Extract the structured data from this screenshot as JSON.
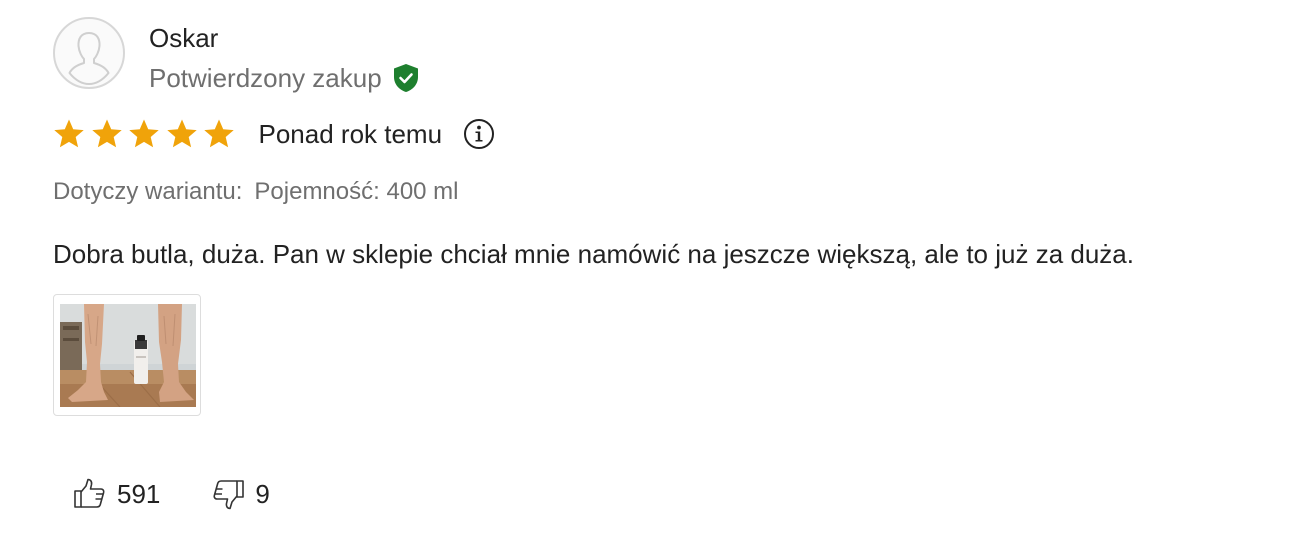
{
  "review": {
    "author": {
      "name": "Oskar",
      "avatar_icon": "user-silhouette-icon"
    },
    "verified": {
      "label": "Potwierdzony zakup",
      "icon": "shield-check-icon",
      "color": "#1e7f2e"
    },
    "rating": {
      "stars": 5,
      "max_stars": 5,
      "star_color": "#f0a30a",
      "date_label": "Ponad rok temu",
      "info_icon": "info-icon"
    },
    "variant": {
      "label": "Dotyczy wariantu:",
      "value": "Pojemność: 400 ml"
    },
    "text": "Dobra butla, duża. Pan w sklepie chciał mnie namówić na jeszcze większą, ale to już za duża.",
    "photos": [
      {
        "icon": "review-photo-thumbnail"
      }
    ],
    "votes": {
      "up_count": "591",
      "up_icon": "thumbs-up-icon",
      "down_count": "9",
      "down_icon": "thumbs-down-icon"
    }
  }
}
